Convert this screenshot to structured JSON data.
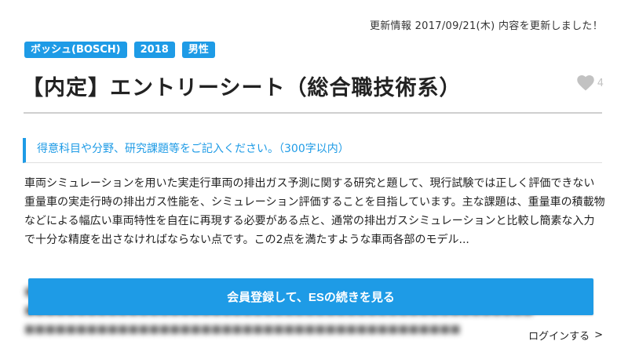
{
  "update_info": "更新情報 2017/09/21(木) 内容を更新しました！",
  "tags": [
    "ボッシュ(BOSCH)",
    "2018",
    "男性"
  ],
  "title": "【内定】エントリーシート（総合職技術系）",
  "like": {
    "count": "4",
    "icon": "heart-icon"
  },
  "question": "得意科目や分野、研究課題等をご記入ください。（300字以内）",
  "answer": "車両シミュレーションを用いた実走行車両の排出ガス予測に関する研究と題して、現行試験では正しく評価できない重量車の実走行時の排出ガス性能を、シミュレーション評価することを目指しています。主な課題は、重量車の積載物などによる幅広い車両特性を自在に再現する必要がある点と、通常の排出ガスシミュレーションと比較し簡素な入力で十分な精度を出さなければならない点です。この2点を満たすような車両各部のモデル...",
  "cta_label": "会員登録して、ESの続きを見る",
  "login_label": "ログインする",
  "colors": {
    "accent": "#1e9be6",
    "like": "#c2c2c2"
  }
}
